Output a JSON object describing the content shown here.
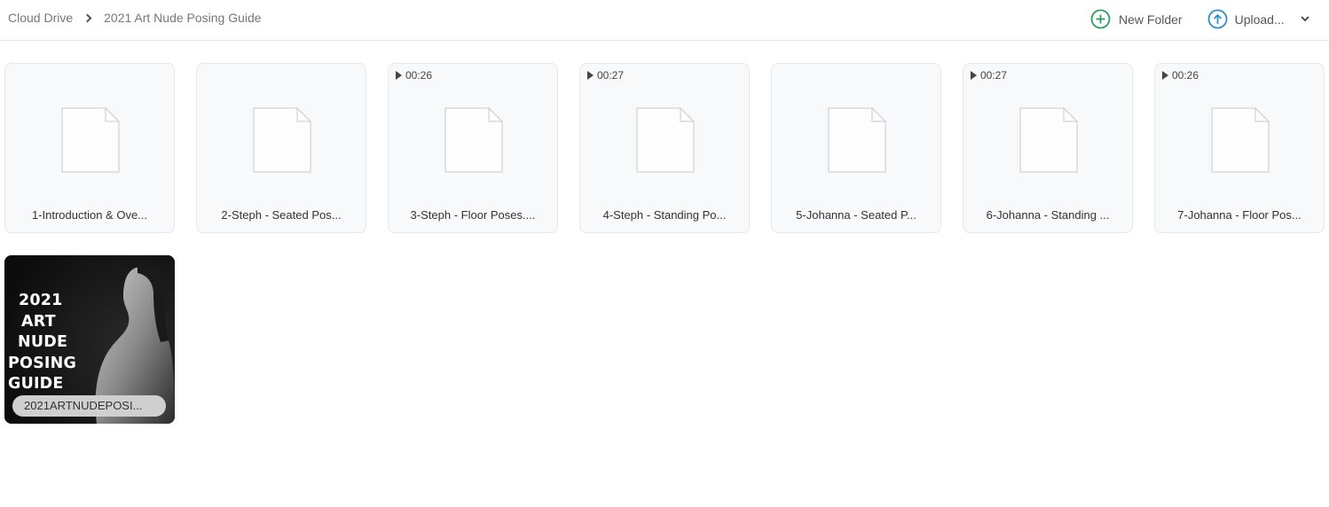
{
  "breadcrumb": {
    "root": "Cloud Drive",
    "current": "2021 Art Nude Posing Guide"
  },
  "toolbar": {
    "new_folder_label": "New Folder",
    "upload_label": "Upload..."
  },
  "colors": {
    "new_folder_icon": "#2e9e62",
    "upload_icon": "#2f8fca"
  },
  "files": [
    {
      "name": "1-Introduction & Ove...",
      "duration": "",
      "icon": "file-icon"
    },
    {
      "name": "2-Steph - Seated Pos...",
      "duration": "",
      "icon": "file-icon"
    },
    {
      "name": "3-Steph - Floor Poses....",
      "duration": "00:26",
      "icon": "file-icon"
    },
    {
      "name": "4-Steph - Standing Po...",
      "duration": "00:27",
      "icon": "file-icon"
    },
    {
      "name": "5-Johanna - Seated P...",
      "duration": "",
      "icon": "file-icon"
    },
    {
      "name": "6-Johanna - Standing ...",
      "duration": "00:27",
      "icon": "file-icon"
    },
    {
      "name": "7-Johanna - Floor Pos...",
      "duration": "00:26",
      "icon": "file-icon"
    }
  ],
  "image_file": {
    "name": "2021ARTNUDEPOSI...",
    "poster_lines": [
      "2021",
      "ART",
      "NUDE",
      "POSING",
      "GUIDE"
    ]
  }
}
